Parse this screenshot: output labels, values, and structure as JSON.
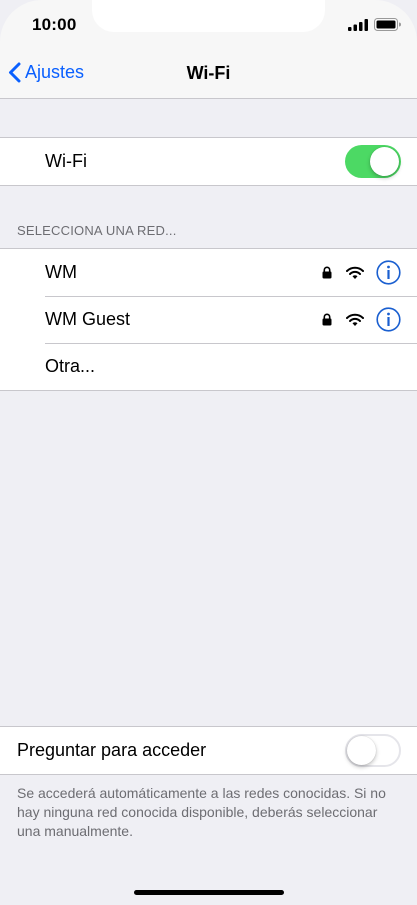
{
  "status_bar": {
    "time": "10:00"
  },
  "nav": {
    "back_label": "Ajustes",
    "title": "Wi-Fi"
  },
  "wifi_toggle": {
    "label": "Wi-Fi",
    "state": "on"
  },
  "networks": {
    "header": "SELECCIONA UNA RED...",
    "items": [
      {
        "name": "WM",
        "secured": true
      },
      {
        "name": "WM Guest",
        "secured": true
      }
    ],
    "other_label": "Otra..."
  },
  "ask_to_join": {
    "label": "Preguntar para acceder",
    "state": "off",
    "footer": "Se accederá automáticamente a las redes conocidas. Si no hay ninguna red conocida disponible, deberás seleccionar una manualmente."
  },
  "colors": {
    "accent": "#0a60ff",
    "switch_on": "#4cd964",
    "background": "#efeff4",
    "info_icon": "#1a5fd0"
  },
  "icons": [
    "chevron-left-icon",
    "cellular-signal-icon",
    "battery-icon",
    "lock-icon",
    "wifi-icon",
    "info-icon"
  ]
}
